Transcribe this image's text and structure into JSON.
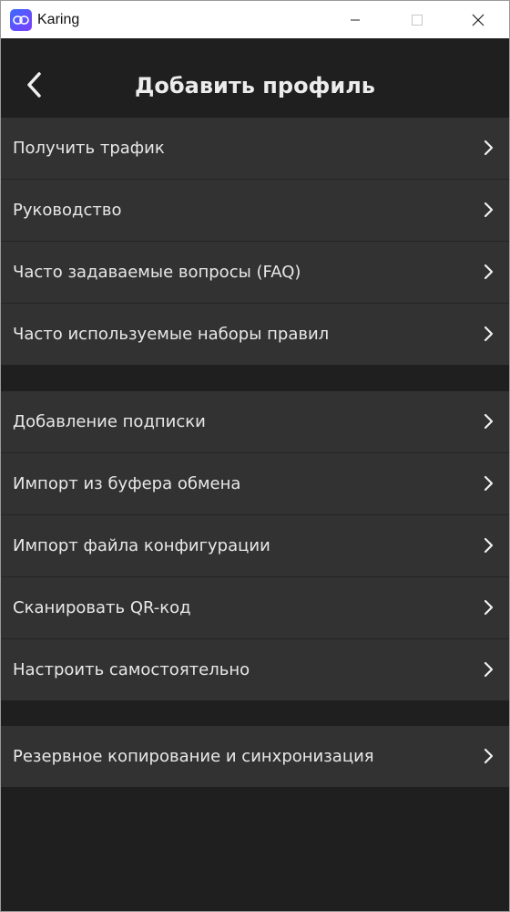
{
  "window": {
    "app_title": "Karing",
    "icon": "karing-app-icon",
    "controls": [
      "minimize-icon",
      "maximize-icon",
      "close-icon"
    ]
  },
  "header": {
    "back_icon": "chevron-left-icon",
    "title": "Добавить профиль"
  },
  "groups": [
    {
      "items": [
        {
          "label": "Получить трафик"
        },
        {
          "label": "Руководство"
        },
        {
          "label": "Часто задаваемые вопросы (FAQ)"
        },
        {
          "label": "Часто используемые наборы правил"
        }
      ]
    },
    {
      "items": [
        {
          "label": "Добавление подписки"
        },
        {
          "label": "Импорт из буфера обмена"
        },
        {
          "label": "Импорт файла конфигурации"
        },
        {
          "label": "Сканировать QR-код"
        },
        {
          "label": "Настроить самостоятельно"
        }
      ]
    },
    {
      "items": [
        {
          "label": "Резервное копирование и синхронизация"
        }
      ]
    }
  ],
  "colors": {
    "background": "#1f1f1f",
    "row_background": "#323232",
    "divider": "#252525",
    "text": "#e8e8e8",
    "titlebar": "#ffffff"
  }
}
